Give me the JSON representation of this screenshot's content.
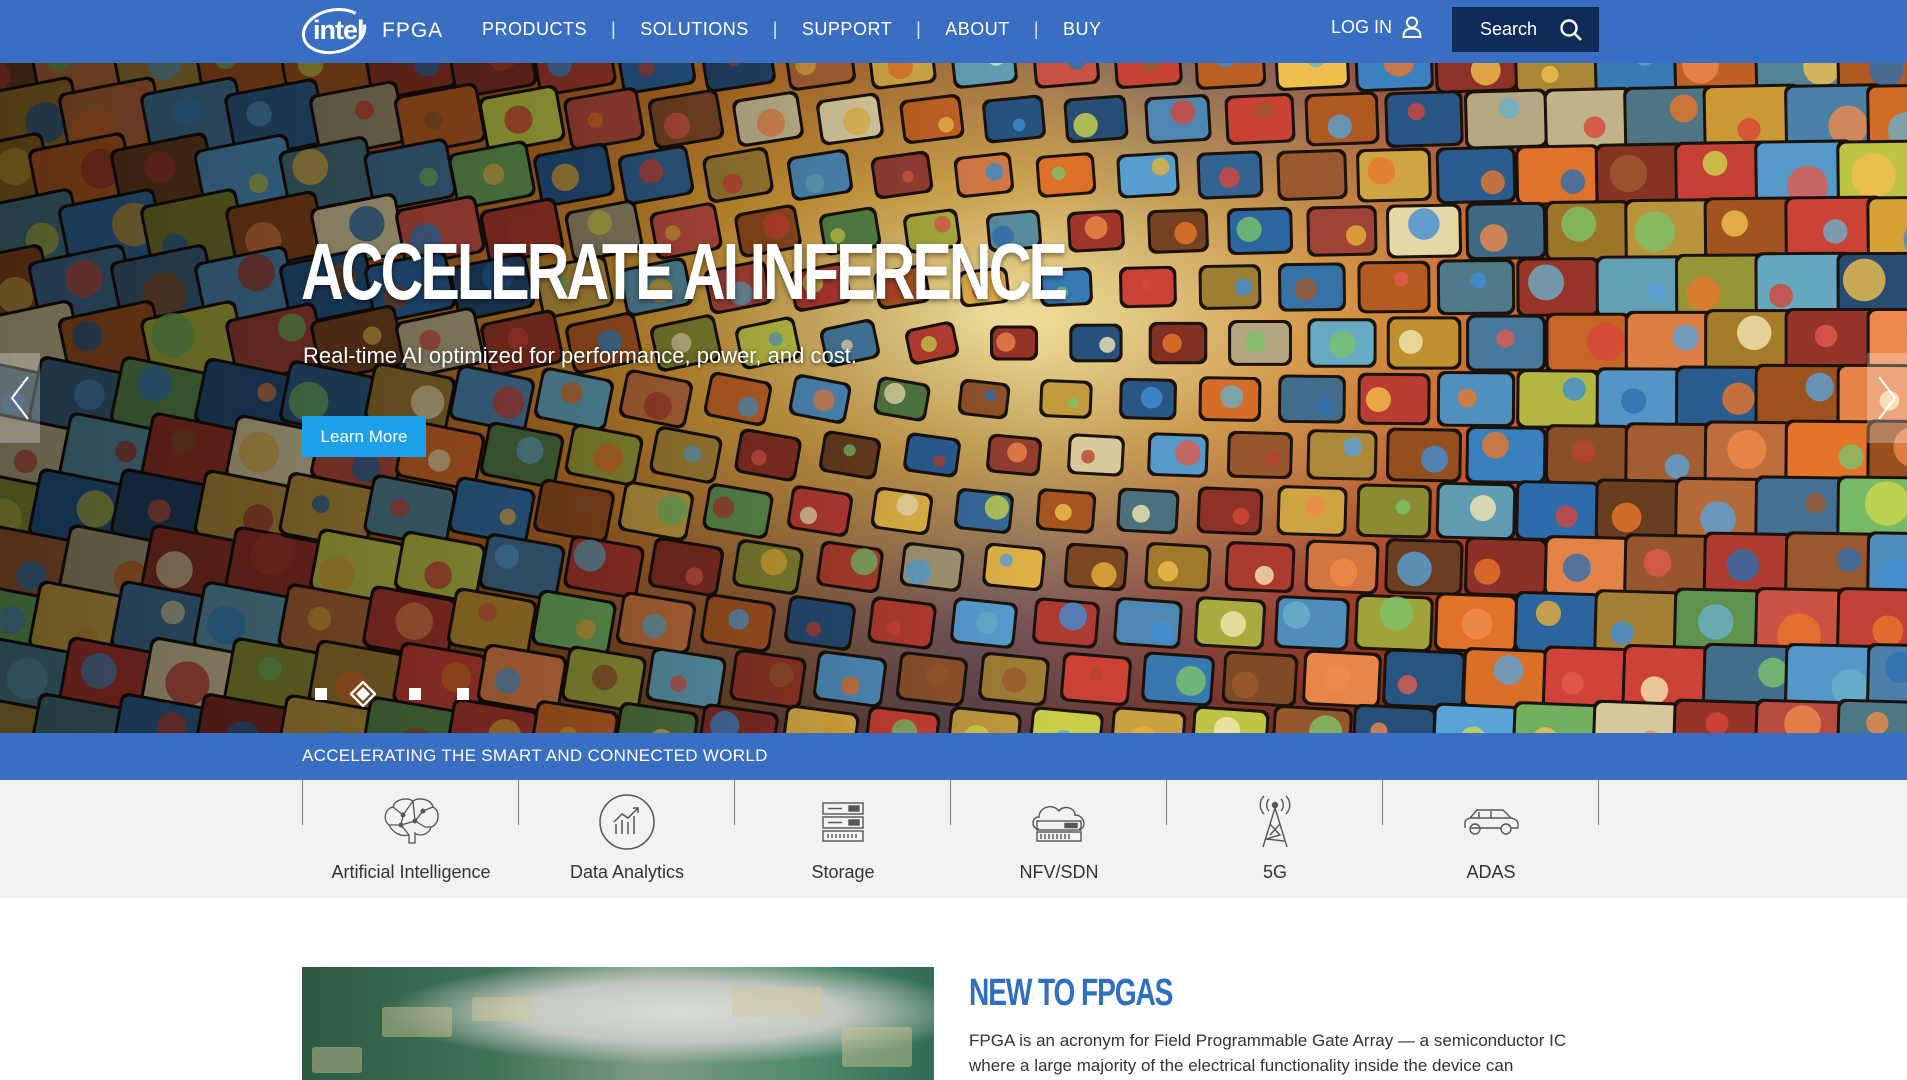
{
  "header": {
    "logo_text": "intel",
    "product_name": "FPGA",
    "nav": [
      "PRODUCTS",
      "SOLUTIONS",
      "SUPPORT",
      "ABOUT",
      "BUY"
    ],
    "nav_separator": "|",
    "login_label": "LOG IN",
    "search_label": "Search"
  },
  "hero": {
    "title": "ACCELERATE AI INFERENCE",
    "subtitle": "Real-time AI optimized for performance, power, and cost.",
    "cta_label": "Learn More",
    "slide_count": 4,
    "active_slide": 2
  },
  "strip": {
    "heading": "ACCELERATING THE SMART AND CONNECTED WORLD"
  },
  "categories": [
    {
      "label": "Artificial Intelligence",
      "icon": "brain-icon"
    },
    {
      "label": "Data Analytics",
      "icon": "analytics-chart-icon"
    },
    {
      "label": "Storage",
      "icon": "storage-icon"
    },
    {
      "label": "NFV/SDN",
      "icon": "cloud-server-icon"
    },
    {
      "label": "5G",
      "icon": "antenna-tower-icon"
    },
    {
      "label": "ADAS",
      "icon": "car-icon"
    }
  ],
  "new_section": {
    "title": "NEW TO FPGAS",
    "body": "FPGA is an acronym for Field Programmable Gate Array — a semiconductor IC where a large majority of the electrical functionality inside the device can"
  },
  "colors": {
    "header_blue": "#3a6ec2",
    "search_navy": "#102a5a",
    "cta_blue": "#1ea1e8",
    "title_blue": "#2f6fc2"
  }
}
